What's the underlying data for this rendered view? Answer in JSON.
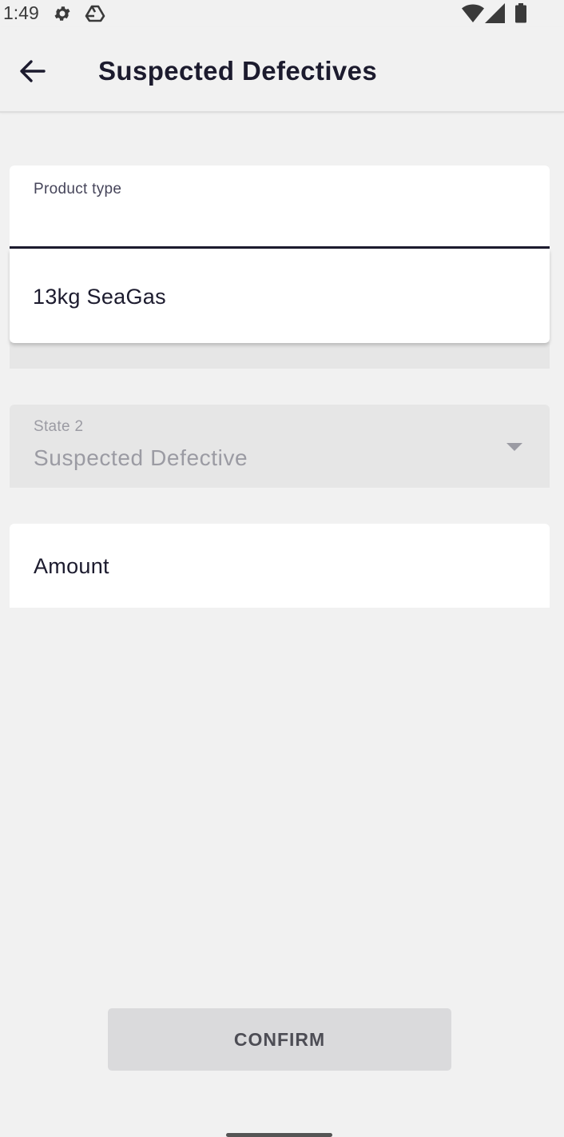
{
  "status_bar": {
    "time": "1:49",
    "icons": [
      "gear-icon",
      "drive-icon",
      "wifi-icon",
      "cell-signal-icon",
      "battery-icon"
    ]
  },
  "app_bar": {
    "back_icon": "arrow-left-icon",
    "title": "Suspected Defectives"
  },
  "form": {
    "product_type": {
      "label": "Product type",
      "value": "",
      "options": [
        "13kg SeaGas"
      ]
    },
    "state": {
      "label": "State 2",
      "value": "Suspected Defective",
      "disabled": true,
      "icon": "caret-down-icon"
    },
    "amount": {
      "label": "Amount",
      "value": ""
    }
  },
  "actions": {
    "confirm_label": "CONFIRM",
    "confirm_enabled": false
  },
  "colors": {
    "background": "#f1f1f1",
    "text_primary": "#1c1b2e",
    "field_disabled": "#e6e6e6",
    "text_disabled": "#9b9ba3",
    "button_disabled": "#dadadc"
  }
}
